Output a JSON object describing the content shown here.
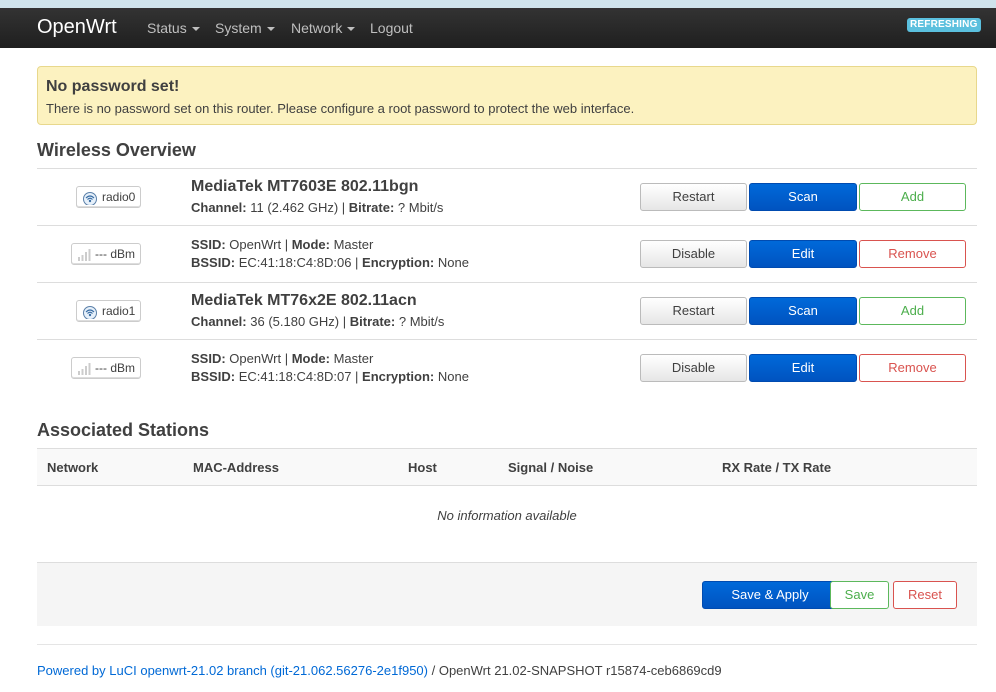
{
  "header": {
    "brand": "OpenWrt",
    "menu": [
      {
        "label": "Status",
        "has_dropdown": true
      },
      {
        "label": "System",
        "has_dropdown": true
      },
      {
        "label": "Network",
        "has_dropdown": true
      },
      {
        "label": "Logout",
        "has_dropdown": false
      }
    ],
    "refresh_badge": "REFRESHING"
  },
  "alert": {
    "title": "No password set!",
    "message": "There is no password set on this router. Please configure a root password to protect the web interface."
  },
  "wireless": {
    "title": "Wireless Overview",
    "devices": [
      {
        "badge": "radio0",
        "name": "MediaTek MT7603E 802.11bgn",
        "channel_label": "Channel:",
        "channel": "11 (2.462 GHz)",
        "bitrate_label": "Bitrate:",
        "bitrate": "? Mbit/s",
        "buttons": {
          "restart": "Restart",
          "scan": "Scan",
          "add": "Add"
        },
        "network": {
          "signal": "--- dBm",
          "ssid_label": "SSID:",
          "ssid": "OpenWrt",
          "mode_label": "Mode:",
          "mode": "Master",
          "bssid_label": "BSSID:",
          "bssid": "EC:41:18:C4:8D:06",
          "encryption_label": "Encryption:",
          "encryption": "None",
          "buttons": {
            "disable": "Disable",
            "edit": "Edit",
            "remove": "Remove"
          }
        }
      },
      {
        "badge": "radio1",
        "name": "MediaTek MT76x2E 802.11acn",
        "channel_label": "Channel:",
        "channel": "36 (5.180 GHz)",
        "bitrate_label": "Bitrate:",
        "bitrate": "? Mbit/s",
        "buttons": {
          "restart": "Restart",
          "scan": "Scan",
          "add": "Add"
        },
        "network": {
          "signal": "--- dBm",
          "ssid_label": "SSID:",
          "ssid": "OpenWrt",
          "mode_label": "Mode:",
          "mode": "Master",
          "bssid_label": "BSSID:",
          "bssid": "EC:41:18:C4:8D:07",
          "encryption_label": "Encryption:",
          "encryption": "None",
          "buttons": {
            "disable": "Disable",
            "edit": "Edit",
            "remove": "Remove"
          }
        }
      }
    ]
  },
  "stations": {
    "title": "Associated Stations",
    "columns": [
      "Network",
      "MAC-Address",
      "Host",
      "Signal / Noise",
      "RX Rate / TX Rate"
    ],
    "empty": "No information available"
  },
  "actions": {
    "save_apply": "Save & Apply",
    "save": "Save",
    "reset": "Reset"
  },
  "footer": {
    "link": "Powered by LuCI openwrt-21.02 branch (git-21.062.56276-2e1f950)",
    "sep": " / ",
    "version": "OpenWrt 21.02-SNAPSHOT r15874-ceb6869cd9"
  },
  "colors": {
    "navbar": "#222222",
    "primary": "#0069d9",
    "success": "#5cb85c",
    "danger": "#d9534f",
    "alert_bg": "#fcf2c0",
    "badge_info": "#5bc0de"
  }
}
